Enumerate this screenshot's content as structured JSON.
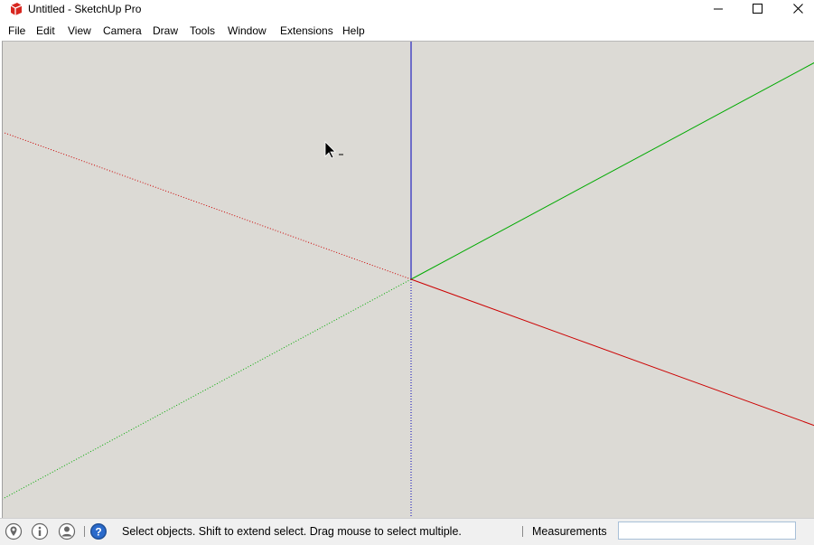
{
  "window": {
    "title": "Untitled - SketchUp Pro",
    "app_icon": "sketchup-logo-icon",
    "controls": [
      "minimize-icon",
      "maximize-icon",
      "close-icon"
    ]
  },
  "menu": {
    "items": [
      "File",
      "Edit",
      "View",
      "Camera",
      "Draw",
      "Tools",
      "Window",
      "Extensions",
      "Help"
    ]
  },
  "viewport": {
    "background": "#dcdad5",
    "axes": {
      "red": "#cc0000",
      "green": "#00aa00",
      "blue": "#0000bb"
    },
    "cursor": "select-arrow-icon"
  },
  "status": {
    "icons": [
      "geo-location-icon",
      "credits-icon",
      "account-icon",
      "instructor-help-icon"
    ],
    "message": "Select objects. Shift to extend select. Drag mouse to select multiple.",
    "measurements_label": "Measurements",
    "measurements_value": ""
  }
}
